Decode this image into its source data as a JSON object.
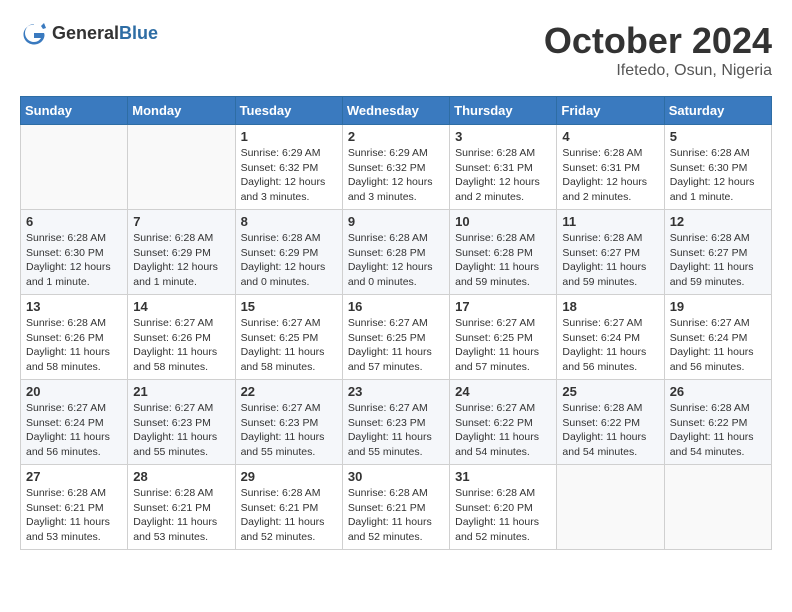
{
  "header": {
    "logo_general": "General",
    "logo_blue": "Blue",
    "month_title": "October 2024",
    "location": "Ifetedo, Osun, Nigeria"
  },
  "weekdays": [
    "Sunday",
    "Monday",
    "Tuesday",
    "Wednesday",
    "Thursday",
    "Friday",
    "Saturday"
  ],
  "weeks": [
    [
      {
        "day": "",
        "detail": ""
      },
      {
        "day": "",
        "detail": ""
      },
      {
        "day": "1",
        "detail": "Sunrise: 6:29 AM\nSunset: 6:32 PM\nDaylight: 12 hours\nand 3 minutes."
      },
      {
        "day": "2",
        "detail": "Sunrise: 6:29 AM\nSunset: 6:32 PM\nDaylight: 12 hours\nand 3 minutes."
      },
      {
        "day": "3",
        "detail": "Sunrise: 6:28 AM\nSunset: 6:31 PM\nDaylight: 12 hours\nand 2 minutes."
      },
      {
        "day": "4",
        "detail": "Sunrise: 6:28 AM\nSunset: 6:31 PM\nDaylight: 12 hours\nand 2 minutes."
      },
      {
        "day": "5",
        "detail": "Sunrise: 6:28 AM\nSunset: 6:30 PM\nDaylight: 12 hours\nand 1 minute."
      }
    ],
    [
      {
        "day": "6",
        "detail": "Sunrise: 6:28 AM\nSunset: 6:30 PM\nDaylight: 12 hours\nand 1 minute."
      },
      {
        "day": "7",
        "detail": "Sunrise: 6:28 AM\nSunset: 6:29 PM\nDaylight: 12 hours\nand 1 minute."
      },
      {
        "day": "8",
        "detail": "Sunrise: 6:28 AM\nSunset: 6:29 PM\nDaylight: 12 hours\nand 0 minutes."
      },
      {
        "day": "9",
        "detail": "Sunrise: 6:28 AM\nSunset: 6:28 PM\nDaylight: 12 hours\nand 0 minutes."
      },
      {
        "day": "10",
        "detail": "Sunrise: 6:28 AM\nSunset: 6:28 PM\nDaylight: 11 hours\nand 59 minutes."
      },
      {
        "day": "11",
        "detail": "Sunrise: 6:28 AM\nSunset: 6:27 PM\nDaylight: 11 hours\nand 59 minutes."
      },
      {
        "day": "12",
        "detail": "Sunrise: 6:28 AM\nSunset: 6:27 PM\nDaylight: 11 hours\nand 59 minutes."
      }
    ],
    [
      {
        "day": "13",
        "detail": "Sunrise: 6:28 AM\nSunset: 6:26 PM\nDaylight: 11 hours\nand 58 minutes."
      },
      {
        "day": "14",
        "detail": "Sunrise: 6:27 AM\nSunset: 6:26 PM\nDaylight: 11 hours\nand 58 minutes."
      },
      {
        "day": "15",
        "detail": "Sunrise: 6:27 AM\nSunset: 6:25 PM\nDaylight: 11 hours\nand 58 minutes."
      },
      {
        "day": "16",
        "detail": "Sunrise: 6:27 AM\nSunset: 6:25 PM\nDaylight: 11 hours\nand 57 minutes."
      },
      {
        "day": "17",
        "detail": "Sunrise: 6:27 AM\nSunset: 6:25 PM\nDaylight: 11 hours\nand 57 minutes."
      },
      {
        "day": "18",
        "detail": "Sunrise: 6:27 AM\nSunset: 6:24 PM\nDaylight: 11 hours\nand 56 minutes."
      },
      {
        "day": "19",
        "detail": "Sunrise: 6:27 AM\nSunset: 6:24 PM\nDaylight: 11 hours\nand 56 minutes."
      }
    ],
    [
      {
        "day": "20",
        "detail": "Sunrise: 6:27 AM\nSunset: 6:24 PM\nDaylight: 11 hours\nand 56 minutes."
      },
      {
        "day": "21",
        "detail": "Sunrise: 6:27 AM\nSunset: 6:23 PM\nDaylight: 11 hours\nand 55 minutes."
      },
      {
        "day": "22",
        "detail": "Sunrise: 6:27 AM\nSunset: 6:23 PM\nDaylight: 11 hours\nand 55 minutes."
      },
      {
        "day": "23",
        "detail": "Sunrise: 6:27 AM\nSunset: 6:23 PM\nDaylight: 11 hours\nand 55 minutes."
      },
      {
        "day": "24",
        "detail": "Sunrise: 6:27 AM\nSunset: 6:22 PM\nDaylight: 11 hours\nand 54 minutes."
      },
      {
        "day": "25",
        "detail": "Sunrise: 6:28 AM\nSunset: 6:22 PM\nDaylight: 11 hours\nand 54 minutes."
      },
      {
        "day": "26",
        "detail": "Sunrise: 6:28 AM\nSunset: 6:22 PM\nDaylight: 11 hours\nand 54 minutes."
      }
    ],
    [
      {
        "day": "27",
        "detail": "Sunrise: 6:28 AM\nSunset: 6:21 PM\nDaylight: 11 hours\nand 53 minutes."
      },
      {
        "day": "28",
        "detail": "Sunrise: 6:28 AM\nSunset: 6:21 PM\nDaylight: 11 hours\nand 53 minutes."
      },
      {
        "day": "29",
        "detail": "Sunrise: 6:28 AM\nSunset: 6:21 PM\nDaylight: 11 hours\nand 52 minutes."
      },
      {
        "day": "30",
        "detail": "Sunrise: 6:28 AM\nSunset: 6:21 PM\nDaylight: 11 hours\nand 52 minutes."
      },
      {
        "day": "31",
        "detail": "Sunrise: 6:28 AM\nSunset: 6:20 PM\nDaylight: 11 hours\nand 52 minutes."
      },
      {
        "day": "",
        "detail": ""
      },
      {
        "day": "",
        "detail": ""
      }
    ]
  ]
}
